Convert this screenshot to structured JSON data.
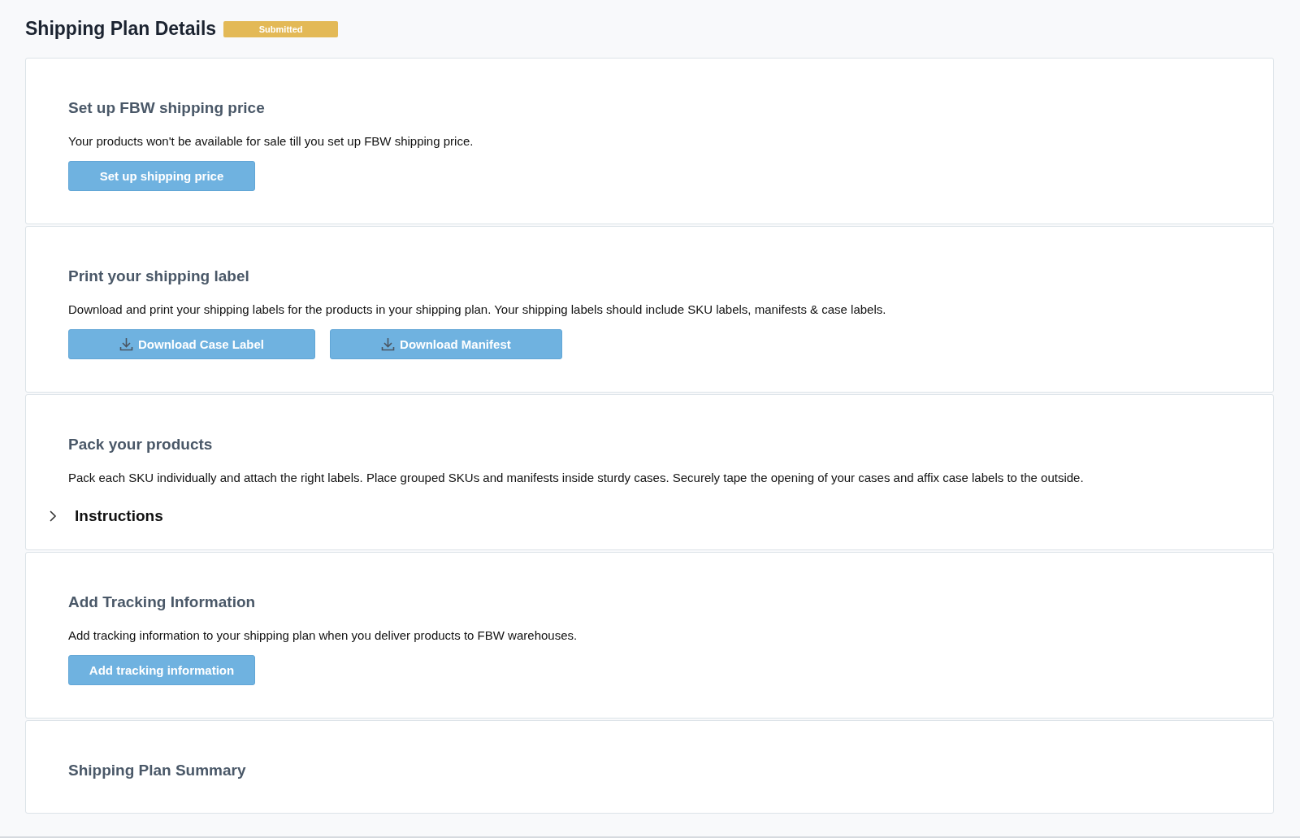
{
  "page": {
    "title": "Shipping Plan Details",
    "status": "Submitted"
  },
  "sections": [
    {
      "title": "Set up FBW shipping price",
      "text": "Your products won't be available for sale till you set up FBW shipping price.",
      "buttons": [
        {
          "kind": "plain",
          "label": "Set up shipping price"
        }
      ]
    },
    {
      "title": "Print your shipping label",
      "text": "Download and print your shipping labels for the products in your shipping plan. Your shipping labels should include SKU labels, manifests & case labels.",
      "buttons": [
        {
          "kind": "download",
          "label": "Download Case Label"
        },
        {
          "kind": "download",
          "label": "Download Manifest"
        }
      ]
    },
    {
      "title": "Pack your products",
      "text": "Pack each SKU individually and attach the right labels. Place grouped SKUs and manifests inside sturdy cases. Securely tape the opening of your cases and affix case labels to the outside.",
      "expander": {
        "label": "Instructions",
        "expanded": false
      }
    },
    {
      "title": "Add Tracking Information",
      "text": "Add tracking information to your shipping plan when you deliver products to FBW warehouses.",
      "buttons": [
        {
          "kind": "plain",
          "label": "Add tracking information"
        }
      ]
    },
    {
      "title": "Shipping Plan Summary"
    }
  ]
}
